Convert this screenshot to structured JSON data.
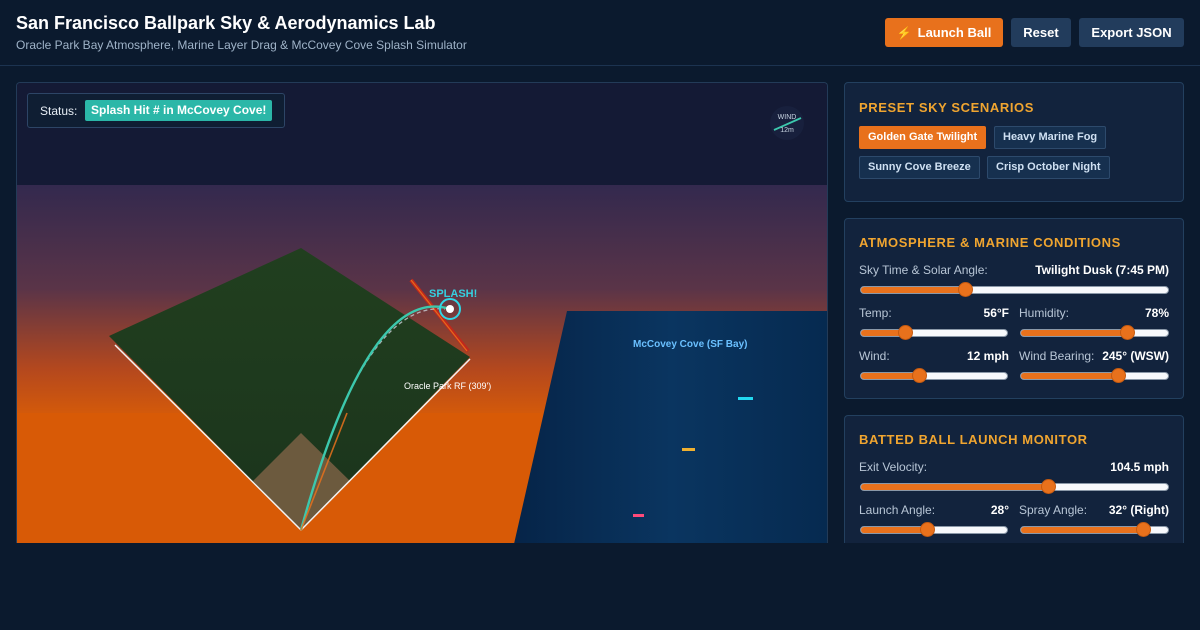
{
  "header": {
    "title": "San Francisco Ballpark Sky & Aerodynamics Lab",
    "subtitle": "Oracle Park Bay Atmosphere, Marine Layer Drag & McCovey Cove Splash Simulator",
    "launch_label": "Launch Ball",
    "launch_icon": "lightning-bolt-icon",
    "reset_label": "Reset",
    "export_label": "Export JSON"
  },
  "viz": {
    "status_label": "Status:",
    "status_value": "Splash Hit # in McCovey Cove!",
    "splash_label": "SPLASH!",
    "fence_label": "Oracle Park RF (309')",
    "cove_label": "McCovey Cove (SF Bay)",
    "compass_label": "WIND",
    "compass_speed": "12m",
    "colors": {
      "sky": "#141a35",
      "sunset": "#d95a08",
      "water": "#08305a",
      "field": "#1f3a1f",
      "accent": "#e8711c",
      "trajectory": "#3cc8ad",
      "label": "#35d0e0"
    }
  },
  "presets": {
    "title": "PRESET SKY SCENARIOS",
    "items": [
      {
        "label": "Golden Gate Twilight",
        "active": true
      },
      {
        "label": "Heavy Marine Fog",
        "active": false
      },
      {
        "label": "Sunny Cove Breeze",
        "active": false
      },
      {
        "label": "Crisp October Night",
        "active": false
      }
    ]
  },
  "atmosphere": {
    "title": "ATMOSPHERE & MARINE CONDITIONS",
    "sky_time": {
      "label": "Sky Time & Solar Angle:",
      "value": "Twilight Dusk (7:45 PM)",
      "level": 0.34
    },
    "temp": {
      "label": "Temp:",
      "value": "56°F",
      "level": 0.3
    },
    "humidity": {
      "label": "Humidity:",
      "value": "78%",
      "level": 0.72
    },
    "wind": {
      "label": "Wind:",
      "value": "12 mph",
      "level": 0.4
    },
    "wind_bearing": {
      "label": "Wind Bearing:",
      "value": "245° (WSW)",
      "level": 0.66
    }
  },
  "launch": {
    "title": "BATTED BALL LAUNCH MONITOR",
    "exit_velocity": {
      "label": "Exit Velocity:",
      "value": "104.5 mph",
      "level": 0.61
    },
    "launch_angle": {
      "label": "Launch Angle:",
      "value": "28°",
      "level": 0.45
    },
    "spray_angle": {
      "label": "Spray Angle:",
      "value": "32° (Right)",
      "level": 0.83
    }
  }
}
